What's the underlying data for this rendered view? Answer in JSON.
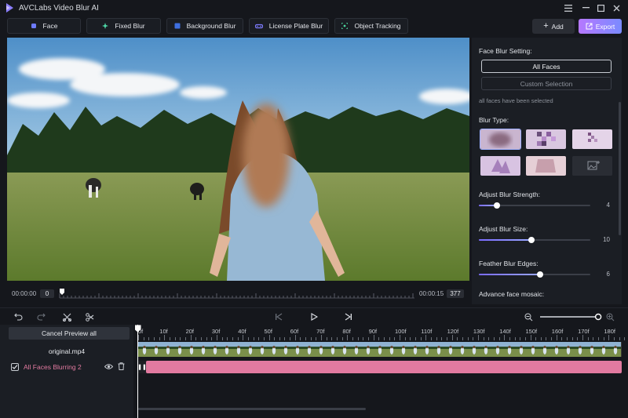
{
  "window": {
    "title": "AVCLabs Video Blur AI"
  },
  "toolbar": {
    "tabs": [
      {
        "label": "Face",
        "icon": "face-icon",
        "color": "#6e7bff"
      },
      {
        "label": "Fixed Blur",
        "icon": "fixed-blur-icon",
        "color": "#4dd6a6"
      },
      {
        "label": "Background Blur",
        "icon": "background-icon",
        "color": "#5a8bff"
      },
      {
        "label": "License Plate Blur",
        "icon": "car-icon",
        "color": "#7d7bff"
      },
      {
        "label": "Object Tracking",
        "icon": "tracking-icon",
        "color": "#4ad69c"
      }
    ],
    "add_label": "Add",
    "export_label": "Export"
  },
  "preview": {
    "start_time": "00:00:00",
    "current_frame": "0",
    "end_time": "00:00:15",
    "total_frames": "377"
  },
  "settings": {
    "face_blur_heading": "Face Blur Setting:",
    "option_all": "All Faces",
    "option_custom": "Custom Selection",
    "status_note": "all faces have been selected",
    "blur_type_heading": "Blur Type:",
    "sliders": [
      {
        "label": "Adjust Blur Strength:",
        "value": "4",
        "fraction": 0.16
      },
      {
        "label": "Adjust Blur Size:",
        "value": "10",
        "fraction": 0.47
      },
      {
        "label": "Feather Blur Edges:",
        "value": "6",
        "fraction": 0.55
      }
    ],
    "advance_heading": "Advance face mosaic:"
  },
  "layers": {
    "cancel_label": "Cancel Preview all",
    "video_file": "original.mp4",
    "effect_layer": "All Faces Blurring 2",
    "effect_color": "#e27aa0"
  },
  "timeline": {
    "ruler": [
      "0f",
      "10f",
      "20f",
      "30f",
      "40f",
      "50f",
      "60f",
      "70f",
      "80f",
      "90f",
      "100f",
      "110f",
      "120f",
      "130f",
      "140f",
      "150f",
      "160f",
      "170f",
      "180f"
    ],
    "zoom_fraction": 0.95
  },
  "colors": {
    "accent": "#7a8bff",
    "export_gradient_start": "#b678ff",
    "export_gradient_end": "#7a8bff"
  }
}
